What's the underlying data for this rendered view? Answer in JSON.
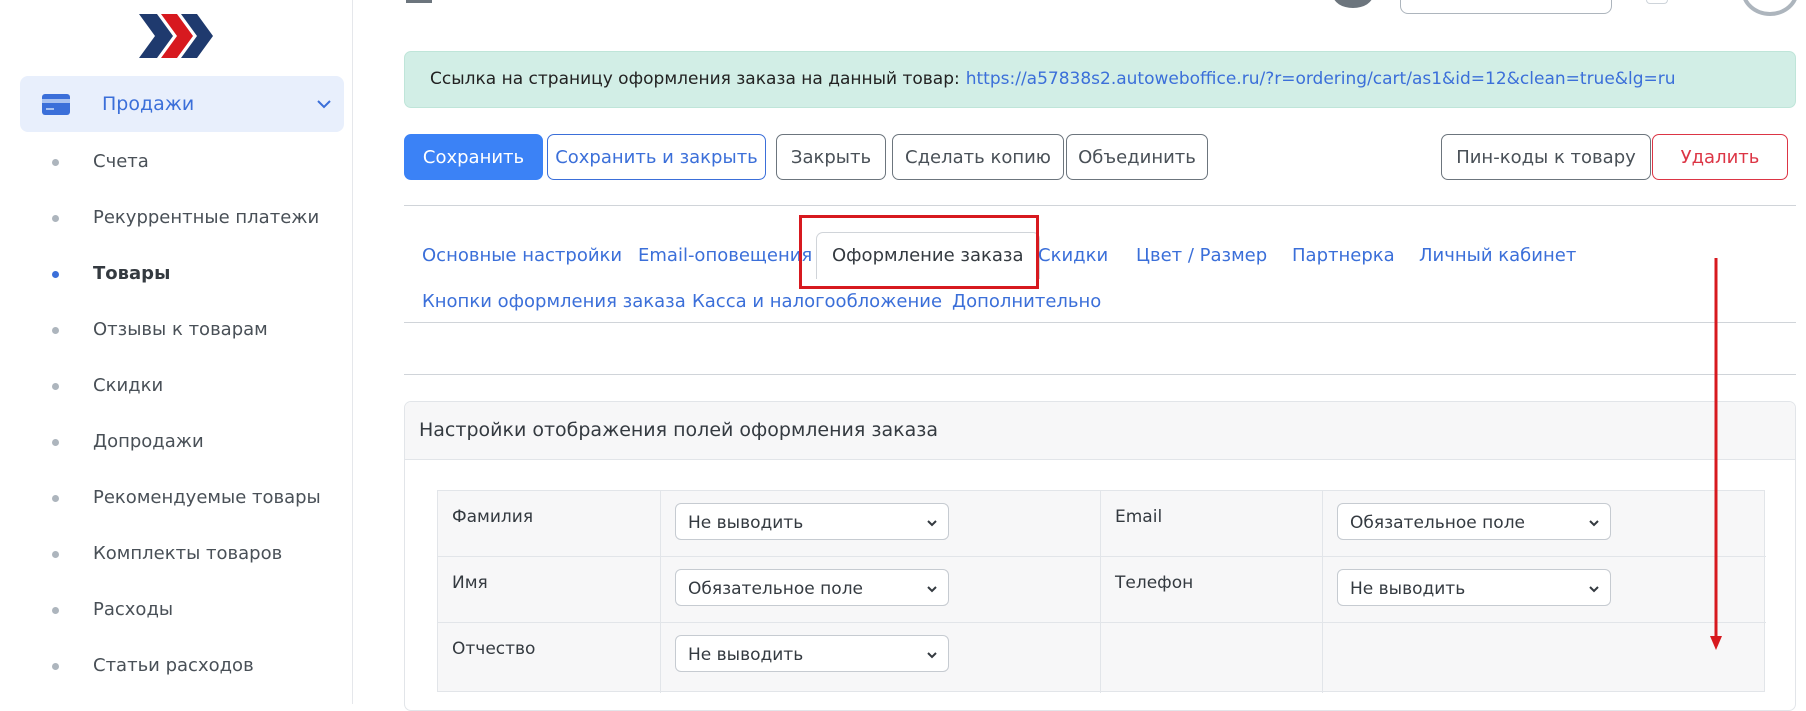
{
  "colors": {
    "accent": "#3b6fd9",
    "primary_button": "#3b82f6",
    "danger": "#dc3545",
    "alert_bg": "#d2eee6",
    "annotation_red": "#d7191f",
    "logo_dark": "#1f3a6e",
    "logo_red": "#d7191f"
  },
  "sidebar": {
    "logo_icon": "chevron-logo-icon",
    "section": {
      "icon": "credit-card-icon",
      "label": "Продажи",
      "expand_icon": "chevron-down-icon"
    },
    "items": [
      {
        "label": "Счета",
        "active": false
      },
      {
        "label": "Рекуррентные платежи",
        "active": false
      },
      {
        "label": "Товары",
        "active": true
      },
      {
        "label": "Отзывы к товарам",
        "active": false
      },
      {
        "label": "Скидки",
        "active": false
      },
      {
        "label": "Допродажи",
        "active": false
      },
      {
        "label": "Рекомендуемые товары",
        "active": false
      },
      {
        "label": "Комплекты товаров",
        "active": false
      },
      {
        "label": "Расходы",
        "active": false
      },
      {
        "label": "Статьи расходов",
        "active": false
      }
    ]
  },
  "alert": {
    "text": "Ссылка на страницу оформления заказа на данный товар:",
    "link": "https://a57838s2.autoweboffice.ru/?r=ordering/cart/as1&id=12&clean=true&lg=ru"
  },
  "toolbar": {
    "save": "Сохранить",
    "save_close": "Сохранить и закрыть",
    "close": "Закрыть",
    "copy": "Сделать копию",
    "merge": "Объединить",
    "pins": "Пин-коды к товару",
    "delete": "Удалить"
  },
  "tabs": {
    "row1": [
      "Основные настройки",
      "Email-оповещения",
      "Оформление заказа",
      "Скидки",
      "Цвет / Размер",
      "Партнерка",
      "Личный кабинет"
    ],
    "row2": [
      "Кнопки оформления заказа",
      "Касса и налогообложение",
      "Дополнительно"
    ],
    "active": "Оформление заказа"
  },
  "card": {
    "title": "Настройки отображения полей оформления заказа",
    "fields": [
      {
        "label": "Фамилия",
        "value": "Не выводить"
      },
      {
        "label": "Email",
        "value": "Обязательное поле"
      },
      {
        "label": "Имя",
        "value": "Обязательное поле"
      },
      {
        "label": "Телефон",
        "value": "Не выводить"
      },
      {
        "label": "Отчество",
        "value": "Не выводить"
      }
    ]
  }
}
